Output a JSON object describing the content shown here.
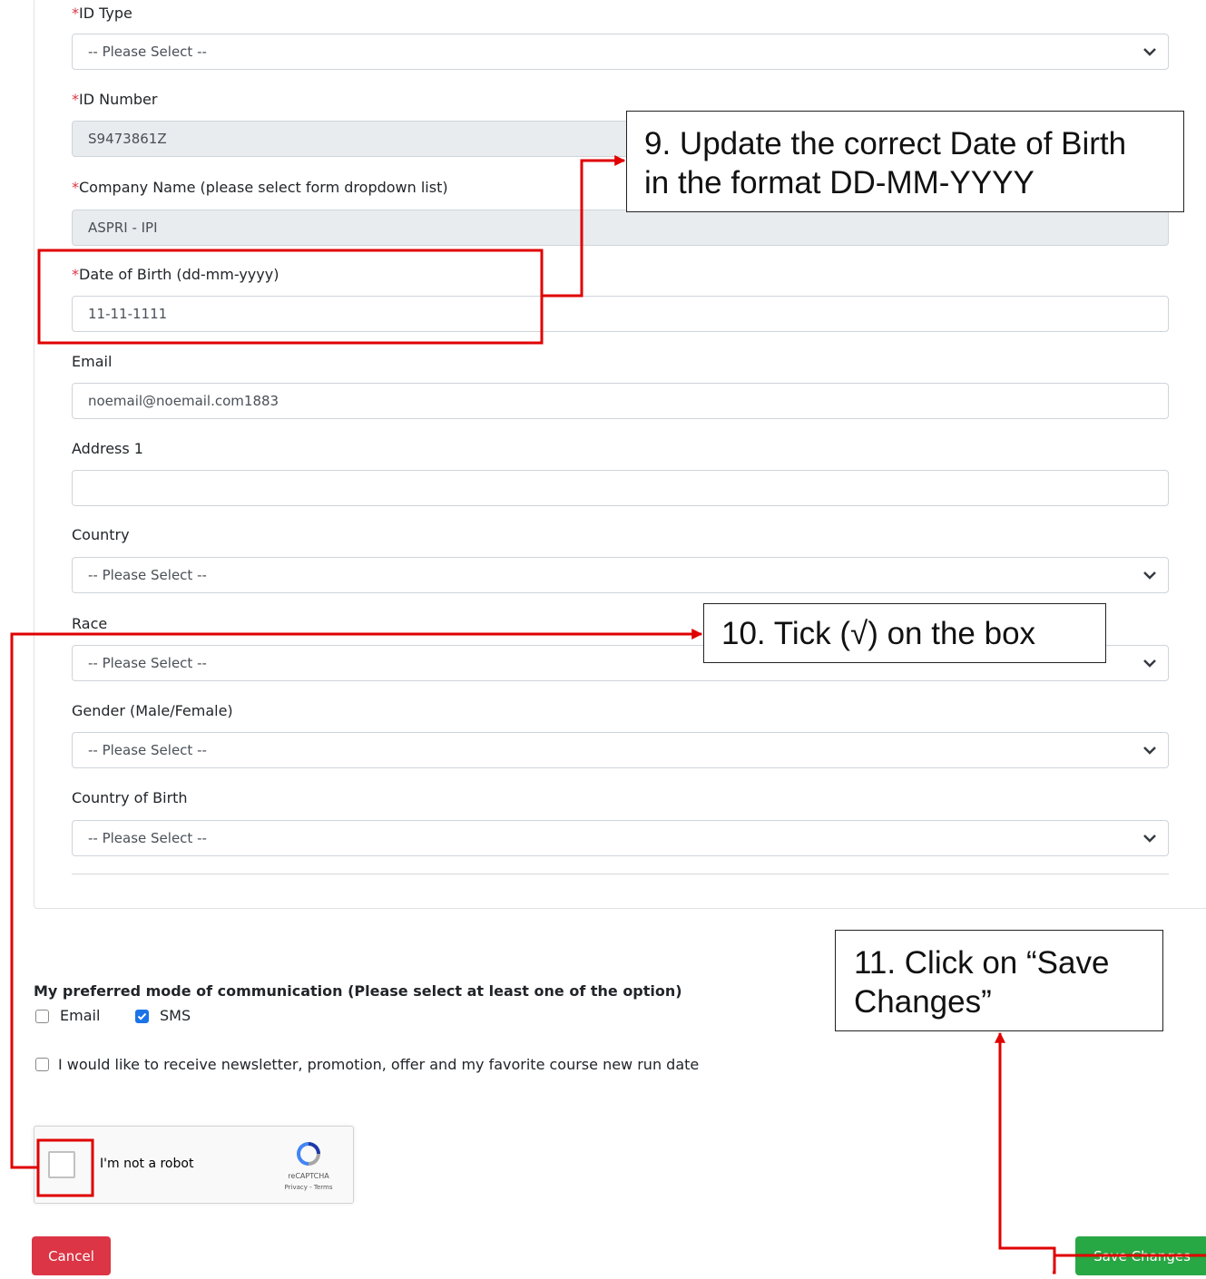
{
  "form": {
    "id_type": {
      "required": "*",
      "label": "ID Type",
      "value": "-- Please Select --"
    },
    "id_number": {
      "required": "*",
      "label": "ID Number",
      "value": "S9473861Z"
    },
    "company": {
      "required": "*",
      "label": "Company Name (please select form dropdown list)",
      "value": "ASPRI - IPI"
    },
    "dob": {
      "required": "*",
      "label": "Date of Birth (dd-mm-yyyy)",
      "value": "11-11-1111"
    },
    "email": {
      "label": "Email",
      "value": "noemail@noemail.com1883"
    },
    "address1": {
      "label": "Address 1",
      "value": ""
    },
    "country": {
      "label": "Country",
      "value": "-- Please Select --"
    },
    "race": {
      "label": "Race",
      "value": "-- Please Select --"
    },
    "gender": {
      "label": "Gender (Male/Female)",
      "value": "-- Please Select --"
    },
    "country_of_birth": {
      "label": "Country of Birth",
      "value": "-- Please Select --"
    }
  },
  "communication": {
    "title": "My preferred mode of communication (Please select at least one of the option)",
    "email_label": "Email",
    "email_checked": false,
    "sms_label": "SMS",
    "sms_checked": true
  },
  "newsletter": {
    "label": "I would like to receive newsletter, promotion, offer and my favorite course new run date",
    "checked": false
  },
  "recaptcha": {
    "label": "I'm not a robot",
    "brand": "reCAPTCHA",
    "links": "Privacy - Terms",
    "checked": false
  },
  "buttons": {
    "cancel": "Cancel",
    "save": "Save Changes"
  },
  "callouts": {
    "step9_line1": "9. Update the correct Date of Birth",
    "step9_line2": "in the format DD-MM-YYYY",
    "step10": "10. Tick (√) on the box",
    "step11_line1": "11. Click on “Save",
    "step11_line2": "Changes”"
  },
  "colors": {
    "annotation_red": "#e00000",
    "save_green": "#28a745",
    "cancel_red": "#dc3545",
    "checkbox_blue": "#1a73e8",
    "required_red": "#dc3545"
  }
}
